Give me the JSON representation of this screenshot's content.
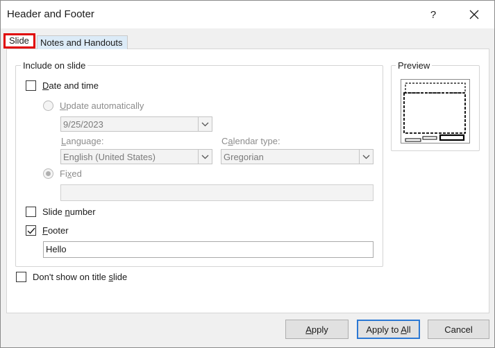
{
  "window": {
    "title": "Header and Footer",
    "help_label": "?"
  },
  "tabs": [
    {
      "label": "Slide",
      "active": true,
      "highlight_color": "#e00000"
    },
    {
      "label": "Notes and Handouts",
      "active": false
    }
  ],
  "include_group": {
    "legend": "Include on slide",
    "date_and_time": {
      "label_ul": "D",
      "label_rest": "ate and time",
      "checked": false
    },
    "update_automatically": {
      "label_ul": "U",
      "label_rest": "pdate automatically",
      "selected": false
    },
    "date_combo": {
      "value": "9/25/2023"
    },
    "language": {
      "label_ul": "L",
      "label_rest": "anguage:",
      "value": "English (United States)"
    },
    "calendar_type": {
      "label_pre": "C",
      "label_ul": "a",
      "label_rest": "lendar type:",
      "value": "Gregorian"
    },
    "fixed": {
      "label_pre": "Fi",
      "label_ul": "x",
      "label_rest": "ed",
      "selected": true,
      "value": ""
    },
    "slide_number": {
      "label_pre": "Slide ",
      "label_ul": "n",
      "label_rest": "umber",
      "checked": false
    },
    "footer": {
      "label_ul": "F",
      "label_rest": "ooter",
      "checked": true,
      "value": "Hello"
    }
  },
  "dont_show_title": {
    "label_pre": "Don't show on title ",
    "label_ul": "s",
    "label_rest": "lide",
    "checked": false
  },
  "preview": {
    "legend": "Preview"
  },
  "buttons": {
    "apply": {
      "label_ul": "A",
      "label_rest": "pply"
    },
    "apply_all": {
      "label_pre": "Apply to ",
      "label_ul": "A",
      "label_rest": "ll"
    },
    "cancel": {
      "label": "Cancel"
    }
  },
  "colors": {
    "accent": "#2b78d4",
    "tab_highlight": "#e00000",
    "inactive_tab_bg": "#dcebf7"
  }
}
